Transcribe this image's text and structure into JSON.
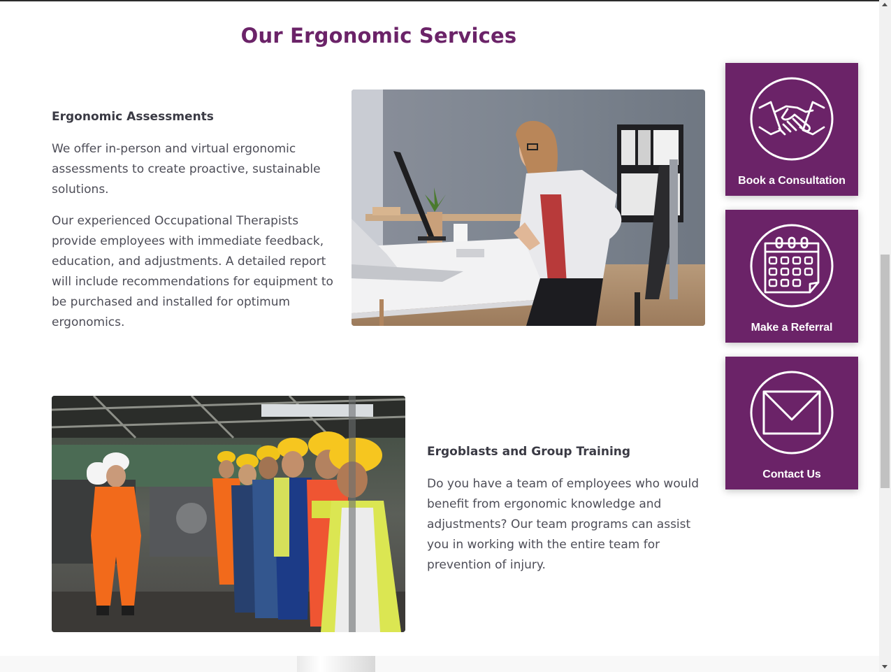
{
  "page": {
    "title": "Our Ergonomic Services"
  },
  "assessments": {
    "heading": "Ergonomic Assessments",
    "paragraphs": [
      "We offer in-person and virtual ergonomic assessments to create proactive, sustainable solutions.",
      "Our experienced Occupational Therapists provide employees with immediate feedback, education, and adjustments. A detailed report will include recommendations for equipment to be purchased and installed for optimum ergonomics."
    ],
    "image_icon": "office-worker-back-pain-photo"
  },
  "training": {
    "heading": "Ergoblasts and Group Training",
    "paragraphs": [
      "Do you have a team of employees who would benefit from ergonomic knowledge and adjustments? Our team programs can assist you in working with the entire team for prevention of injury."
    ],
    "image_icon": "factory-workers-training-photo"
  },
  "cta": [
    {
      "label": "Book a Consultation",
      "icon": "handshake-icon"
    },
    {
      "label": "Make a Referral",
      "icon": "calendar-icon"
    },
    {
      "label": "Contact Us",
      "icon": "envelope-icon"
    }
  ],
  "colors": {
    "brand_purple": "#6b2368",
    "heading_text": "#3a3a44",
    "body_text": "#4d4d57"
  }
}
